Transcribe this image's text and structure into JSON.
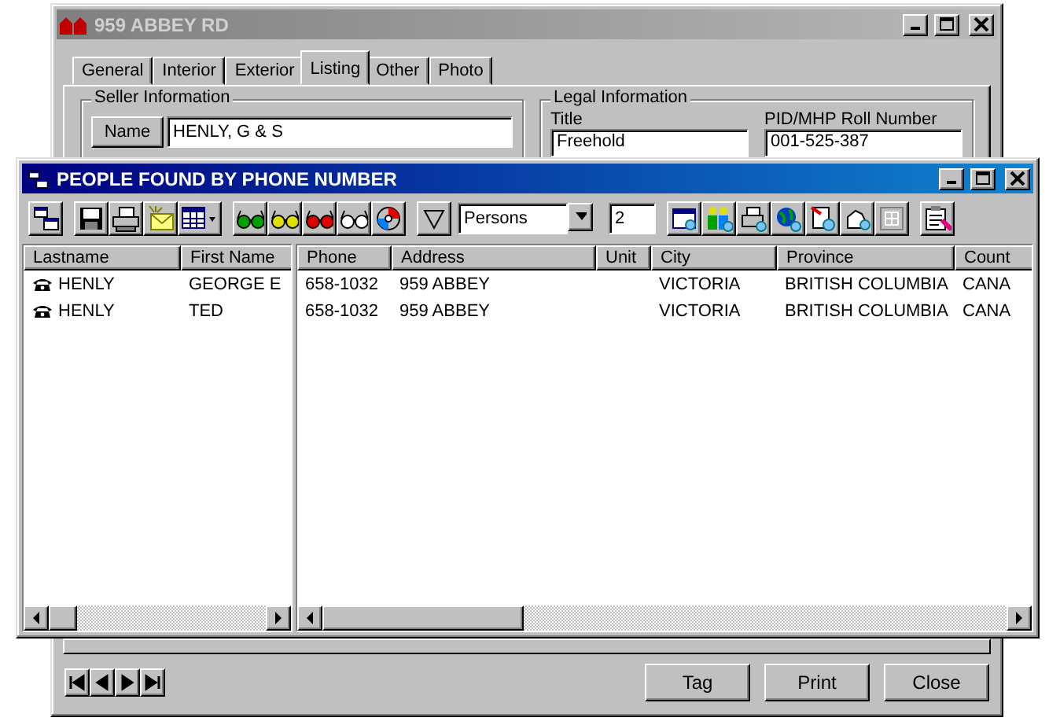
{
  "back_window": {
    "title": "959 ABBEY RD",
    "tabs": [
      {
        "label": "General",
        "selected": false
      },
      {
        "label": "Interior",
        "selected": false
      },
      {
        "label": "Exterior",
        "selected": false
      },
      {
        "label": "Listing",
        "selected": true
      },
      {
        "label": "Other",
        "selected": false
      },
      {
        "label": "Photo",
        "selected": false
      }
    ],
    "seller_information": {
      "legend": "Seller Information",
      "name_button": "Name",
      "name_value": "HENLY, G & S"
    },
    "legal_information": {
      "legend": "Legal Information",
      "title_label": "Title",
      "title_value": "Freehold",
      "pid_label": "PID/MHP Roll Number",
      "pid_value": "001-525-387"
    },
    "buttons": [
      "Tag",
      "Print",
      "Close"
    ]
  },
  "dialog": {
    "title": "PEOPLE FOUND BY PHONE NUMBER",
    "filter_select": "Persons",
    "count_field": "2",
    "left_columns": [
      "Lastname",
      "First Name"
    ],
    "right_columns": [
      "Phone",
      "Address",
      "Unit",
      "City",
      "Province",
      "Count"
    ],
    "rows": [
      {
        "lastname": "HENLY",
        "first_name": "GEORGE E",
        "phone": "658-1032",
        "address": "959 ABBEY",
        "city": "VICTORIA",
        "province": "BRITISH COLUMBIA",
        "column_7": "CANA"
      },
      {
        "lastname": "HENLY",
        "first_name": "TED",
        "phone": "658-1032",
        "address": "959 ABBEY",
        "city": "VICTORIA",
        "province": "BRITISH COLUMBIA",
        "column_7": "CANA"
      }
    ]
  }
}
